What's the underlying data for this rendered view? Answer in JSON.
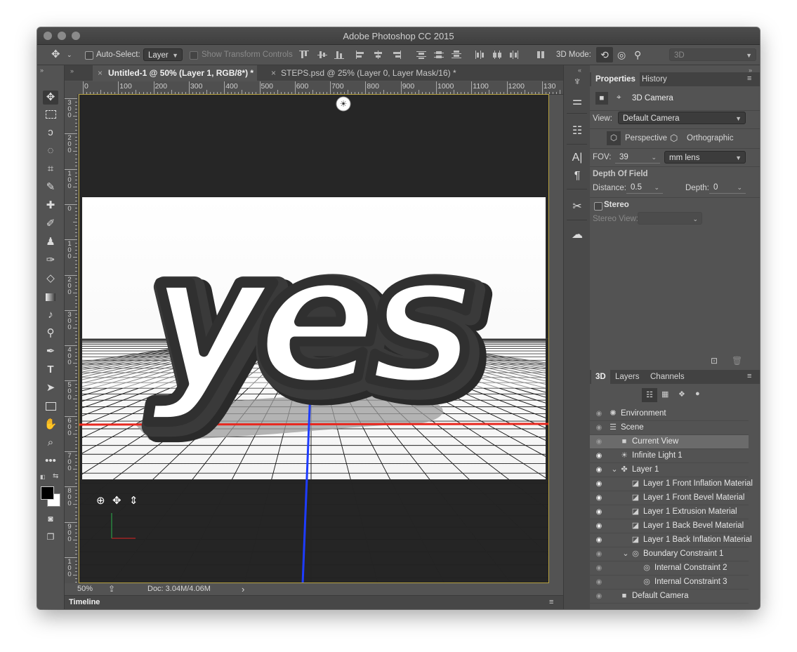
{
  "window": {
    "title": "Adobe Photoshop CC 2015"
  },
  "options_bar": {
    "auto_select_label": "Auto-Select:",
    "auto_select_value": "Layer",
    "show_transform_controls": "Show Transform Controls",
    "mode_label": "3D Mode:",
    "workspace_value": "3D"
  },
  "tabs": [
    {
      "label": "Untitled-1 @ 50% (Layer 1, RGB/8*) *",
      "active": true
    },
    {
      "label": "STEPS.psd @ 25% (Layer 0, Layer Mask/16) *",
      "active": false
    }
  ],
  "ruler": {
    "top": [
      "0",
      "100",
      "200",
      "300",
      "400",
      "500",
      "600",
      "700",
      "800",
      "900",
      "1000",
      "1100",
      "1200",
      "130"
    ],
    "left": [
      "300",
      "200",
      "100",
      "0",
      "100",
      "200",
      "300",
      "400",
      "500",
      "600",
      "700",
      "800",
      "900",
      "100"
    ]
  },
  "canvas": {
    "text": "yes"
  },
  "status": {
    "zoom": "50%",
    "doc": "Doc: 3.04M/4.06M",
    "arrow": "›"
  },
  "timeline": {
    "label": "Timeline"
  },
  "properties": {
    "tabs": [
      "Properties",
      "History"
    ],
    "header": "3D Camera",
    "view_label": "View:",
    "view_value": "Default Camera",
    "perspective": "Perspective",
    "orthographic": "Orthographic",
    "fov_label": "FOV:",
    "fov_value": "39",
    "lens_value": "mm lens",
    "dof_title": "Depth Of Field",
    "distance_label": "Distance:",
    "distance_value": "0.5",
    "depth_label": "Depth:",
    "depth_value": "0",
    "stereo_label": "Stereo",
    "stereo_view_label": "Stereo View:"
  },
  "layers_panel": {
    "tabs": [
      "3D",
      "Layers",
      "Channels"
    ],
    "rows": [
      {
        "name": "Environment",
        "icon": "environment-icon",
        "indent": 0,
        "selected": false,
        "eye": "dim"
      },
      {
        "name": "Scene",
        "icon": "scene-icon",
        "indent": 0,
        "selected": false,
        "eye": "dim"
      },
      {
        "name": "Current View",
        "icon": "camera-icon",
        "indent": 1,
        "selected": true,
        "eye": "dim"
      },
      {
        "name": "Infinite Light 1",
        "icon": "light-icon",
        "indent": 1,
        "selected": false,
        "eye": "on"
      },
      {
        "name": "Layer 1",
        "icon": "mesh-icon",
        "indent": 1,
        "selected": false,
        "eye": "on",
        "expanded": true
      },
      {
        "name": "Layer 1 Front Inflation Material",
        "icon": "material-icon",
        "indent": 2,
        "selected": false,
        "eye": "on"
      },
      {
        "name": "Layer 1 Front Bevel Material",
        "icon": "material-icon",
        "indent": 2,
        "selected": false,
        "eye": "on"
      },
      {
        "name": "Layer 1 Extrusion Material",
        "icon": "material-icon",
        "indent": 2,
        "selected": false,
        "eye": "on"
      },
      {
        "name": "Layer 1 Back Bevel Material",
        "icon": "material-icon",
        "indent": 2,
        "selected": false,
        "eye": "on"
      },
      {
        "name": "Layer 1 Back Inflation Material",
        "icon": "material-icon",
        "indent": 2,
        "selected": false,
        "eye": "on"
      },
      {
        "name": "Boundary Constraint 1",
        "icon": "constraint-icon",
        "indent": 2,
        "selected": false,
        "eye": "dim",
        "expanded": true
      },
      {
        "name": "Internal Constraint 2",
        "icon": "constraint-icon",
        "indent": 3,
        "selected": false,
        "eye": "dim"
      },
      {
        "name": "Internal Constraint 3",
        "icon": "constraint-icon",
        "indent": 3,
        "selected": false,
        "eye": "dim"
      },
      {
        "name": "Default Camera",
        "icon": "camera-icon",
        "indent": 1,
        "selected": false,
        "eye": "dim"
      }
    ]
  },
  "colors": {
    "accent_red": "#e8281f",
    "accent_blue": "#1e3cff",
    "canvas_border": "#b8a241"
  }
}
